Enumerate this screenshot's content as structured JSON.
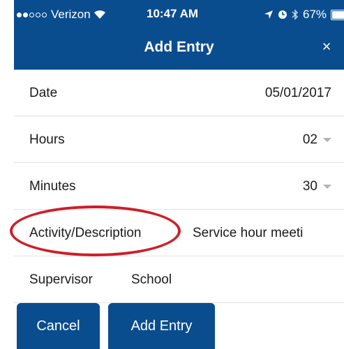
{
  "status_bar": {
    "carrier": "Verizon",
    "time": "10:47 AM",
    "battery": "67%",
    "battery_level": 0.67,
    "signal_bars_filled": 2,
    "signal_bars_total": 5
  },
  "header": {
    "title": "Add Entry",
    "close_glyph": "×"
  },
  "form": {
    "date_label": "Date",
    "date_value": "05/01/2017",
    "hours_label": "Hours",
    "hours_value": "02",
    "minutes_label": "Minutes",
    "minutes_value": "30",
    "activity_label": "Activity/Description",
    "activity_value": "Service hour meeti",
    "supervisor_label": "Supervisor",
    "supervisor_value": "School"
  },
  "buttons": {
    "cancel": "Cancel",
    "add_entry": "Add Entry"
  },
  "colors": {
    "header_bg": "#0a4d8f",
    "highlight": "#cc1f2a"
  }
}
